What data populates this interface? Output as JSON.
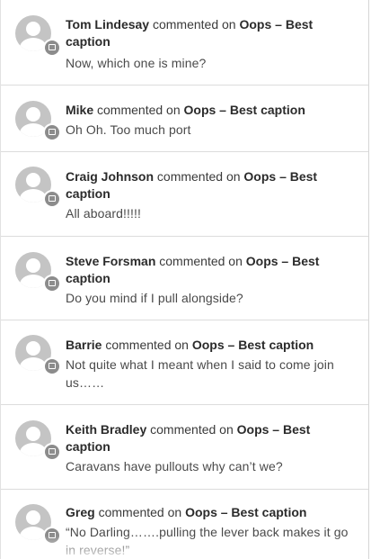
{
  "comments": [
    {
      "author": "Tom Lindesay",
      "connector": "commented on",
      "post": "Oops – Best caption",
      "text": "Now, which one is mine?"
    },
    {
      "author": "Mike",
      "connector": "commented on",
      "post": "Oops – Best caption",
      "text": "Oh Oh. Too much port"
    },
    {
      "author": "Craig Johnson",
      "connector": "commented on",
      "post": "Oops – Best caption",
      "text": "All aboard!!!!!"
    },
    {
      "author": "Steve Forsman",
      "connector": "commented on",
      "post": "Oops – Best caption",
      "text": "Do you mind if I pull alongside?"
    },
    {
      "author": "Barrie",
      "connector": "commented on",
      "post": "Oops – Best caption",
      "text": "Not quite what I meant when I said to come join us……"
    },
    {
      "author": "Keith Bradley",
      "connector": "commented on",
      "post": "Oops – Best caption",
      "text": "Caravans have pullouts why can’t we?"
    },
    {
      "author": "Greg",
      "connector": "commented on",
      "post": "Oops – Best caption",
      "text": "“No Darling…….pulling the lever back makes it go in reverse!”"
    }
  ],
  "icons": {
    "avatar": "default-user-avatar-icon",
    "badge": "comment-bubble-icon"
  }
}
